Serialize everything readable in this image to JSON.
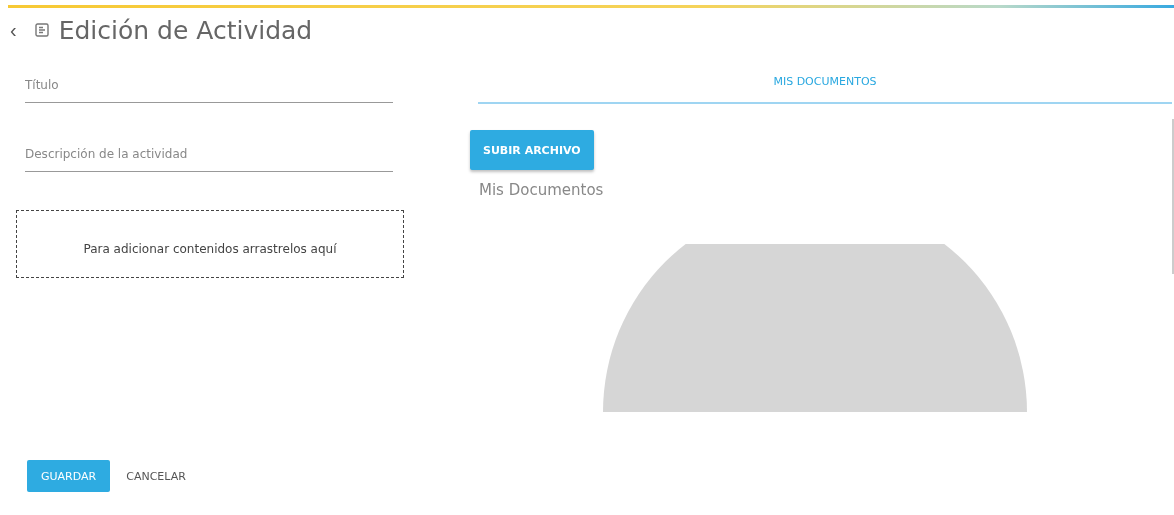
{
  "header": {
    "back": "‹",
    "title": "Edición de Actividad"
  },
  "form": {
    "fields": [
      {
        "placeholder": "Título"
      },
      {
        "placeholder": "Descripción de la actividad"
      }
    ],
    "dropzone": "Para adicionar contenidos arrastrelos aquí"
  },
  "tabs": [
    {
      "label": "MIS DOCUMENTOS",
      "selected": true
    }
  ],
  "upload_button": "SUBIR ARCHIVO",
  "section_title": "Mis Documentos",
  "actions": [
    {
      "label": "GUARDAR",
      "kind": "primary"
    },
    {
      "label": "CANCELAR",
      "kind": "flat"
    }
  ]
}
